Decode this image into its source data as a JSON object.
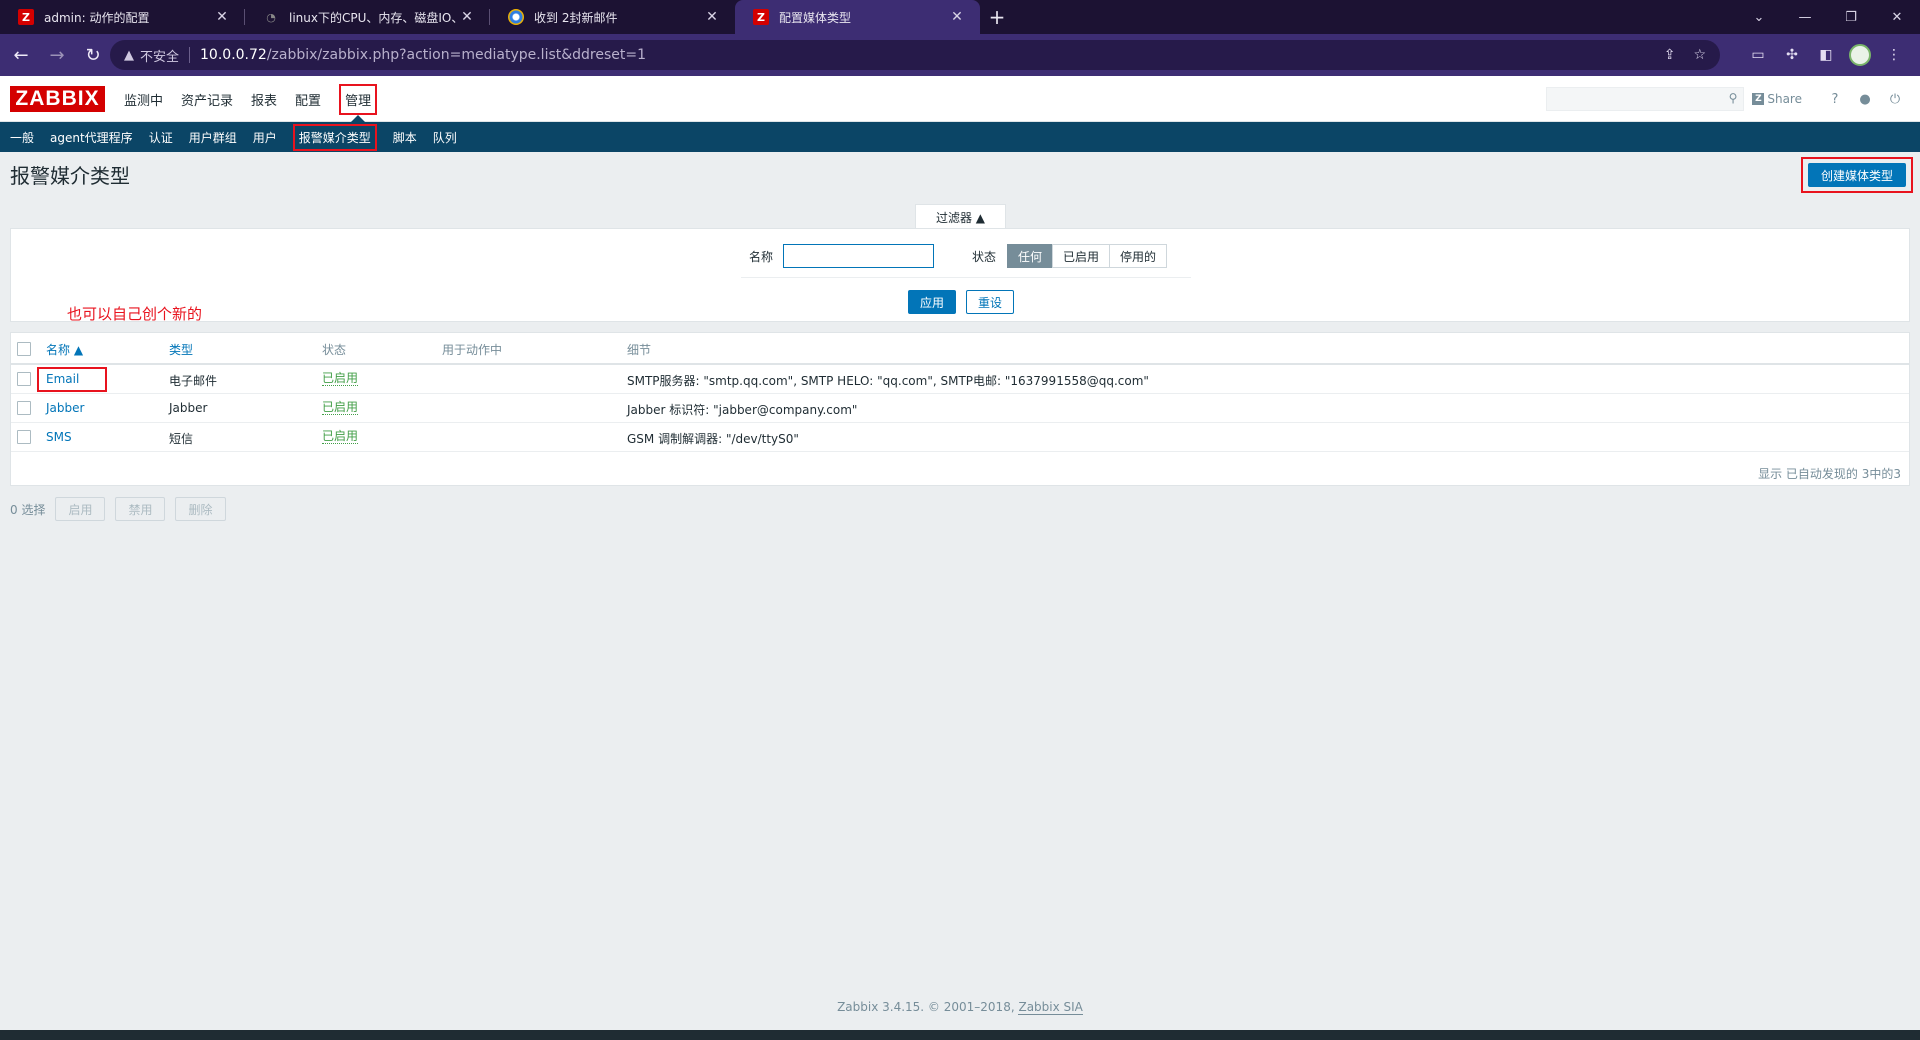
{
  "browser": {
    "tabs": [
      {
        "title": "admin: 动作的配置",
        "favicon": "zabbix-icon"
      },
      {
        "title": "linux下的CPU、内存、磁盘IO、",
        "favicon": "linux-icon"
      },
      {
        "title": "收到 2封新邮件",
        "favicon": "mail-icon"
      },
      {
        "title": "配置媒体类型",
        "favicon": "zabbix-icon"
      }
    ],
    "new_tab": "+",
    "insecure_label": "不安全",
    "url_host": "10.0.0.72",
    "url_path": "/zabbix/zabbix.php?action=mediatype.list&ddreset=1"
  },
  "header": {
    "logo": "ZABBIX",
    "menu": [
      "监测中",
      "资产记录",
      "报表",
      "配置",
      "管理"
    ],
    "share_label": "Share",
    "help": "?"
  },
  "subnav": [
    "一般",
    "agent代理程序",
    "认证",
    "用户群组",
    "用户",
    "报警媒介类型",
    "脚本",
    "队列"
  ],
  "page": {
    "title": "报警媒介类型",
    "create_button": "创建媒体类型"
  },
  "filter": {
    "tab_label": "过滤器 ▲",
    "name_label": "名称",
    "name_value": "",
    "status_label": "状态",
    "status_options": [
      "任何",
      "已启用",
      "停用的"
    ],
    "status_selected": "任何",
    "apply_label": "应用",
    "reset_label": "重设"
  },
  "annotation": "也可以自己创个新的",
  "table": {
    "columns": {
      "name": "名称 ▲",
      "type": "类型",
      "status": "状态",
      "used_in_actions": "用于动作中",
      "details": "细节"
    },
    "rows": [
      {
        "name": "Email",
        "type": "电子邮件",
        "status": "已启用",
        "details": "SMTP服务器: \"smtp.qq.com\", SMTP HELO: \"qq.com\", SMTP电邮: \"1637991558@qq.com\""
      },
      {
        "name": "Jabber",
        "type": "Jabber",
        "status": "已启用",
        "details": "Jabber 标识符: \"jabber@company.com\""
      },
      {
        "name": "SMS",
        "type": "短信",
        "status": "已启用",
        "details": "GSM 调制解调器: \"/dev/ttyS0\""
      }
    ],
    "summary": "显示 已自动发现的 3中的3"
  },
  "bulk": {
    "selected": "0 选择",
    "enable": "启用",
    "disable": "禁用",
    "delete": "删除"
  },
  "footer": {
    "text": "Zabbix 3.4.15. © 2001–2018,",
    "link": "Zabbix SIA"
  },
  "colors": {
    "zabbix_red": "#d40000",
    "nav_blue": "#0b4566",
    "link_blue": "#0275b8",
    "enabled_green": "#429e47",
    "annotation_red": "#e8131e"
  }
}
